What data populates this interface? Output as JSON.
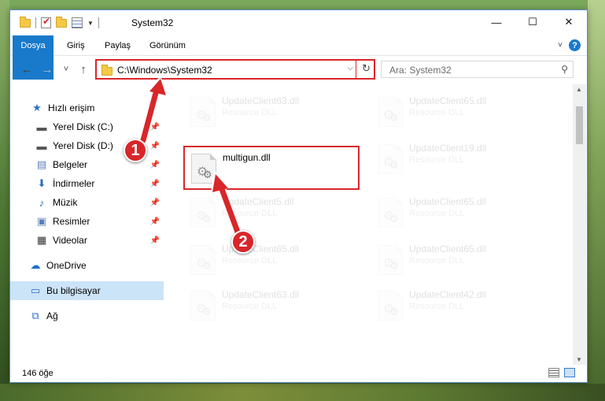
{
  "window": {
    "title": "System32",
    "buttons": [
      "—",
      "☐",
      "✕"
    ]
  },
  "ribbon": {
    "tabs": [
      "Dosya",
      "Giriş",
      "Paylaş",
      "Görünüm"
    ],
    "help": "?"
  },
  "nav": {
    "back": "←",
    "forward": "→",
    "recent": "˅",
    "up": "↑",
    "address": "C:\\Windows\\System32",
    "search_placeholder": "Ara: System32"
  },
  "sidebar": {
    "items": [
      {
        "label": "Hızlı erişim",
        "icon": "star-icon",
        "pinned": false
      },
      {
        "label": "Yerel Disk (C:)",
        "icon": "drive-icon",
        "pinned": true
      },
      {
        "label": "Yerel Disk (D:)",
        "icon": "drive-icon",
        "pinned": true
      },
      {
        "label": "Belgeler",
        "icon": "documents-icon",
        "pinned": true
      },
      {
        "label": "İndirmeler",
        "icon": "download-icon",
        "pinned": true
      },
      {
        "label": "Müzik",
        "icon": "music-icon",
        "pinned": true
      },
      {
        "label": "Resimler",
        "icon": "pictures-icon",
        "pinned": true
      },
      {
        "label": "Videolar",
        "icon": "video-icon",
        "pinned": true
      },
      {
        "label": "OneDrive",
        "icon": "cloud-icon",
        "pinned": false
      },
      {
        "label": "Bu bilgisayar",
        "icon": "computer-icon",
        "pinned": false,
        "selected": true
      },
      {
        "label": "Ağ",
        "icon": "network-icon",
        "pinned": false
      }
    ]
  },
  "files": {
    "left": [
      {
        "name": "UpdateClient63.dll",
        "type": "Resource DLL",
        "faded": true
      },
      {
        "name": "multigun.dll",
        "type": "",
        "faded": false,
        "highlighted": true
      },
      {
        "name": "UpdateClient5.dll",
        "type": "Resource DLL",
        "faded": true
      },
      {
        "name": "UpdateClient65.dll",
        "type": "Resource DLL",
        "faded": true
      },
      {
        "name": "UpdateClient63.dll",
        "type": "Resource DLL",
        "faded": true
      }
    ],
    "right": [
      {
        "name": "UpdateClient65.dll",
        "type": "Resource DLL",
        "faded": true
      },
      {
        "name": "UpdateClient19.dll",
        "type": "Resource DLL",
        "faded": true
      },
      {
        "name": "UpdateClient65.dll",
        "type": "Resource DLL",
        "faded": true
      },
      {
        "name": "UpdateClient65.dll",
        "type": "Resource DLL",
        "faded": true
      },
      {
        "name": "UpdateClient42.dll",
        "type": "Resource DLL",
        "faded": true
      }
    ]
  },
  "status": {
    "count": "146 öğe"
  },
  "annotations": {
    "step1": "1",
    "step2": "2",
    "color": "#d9262a"
  }
}
